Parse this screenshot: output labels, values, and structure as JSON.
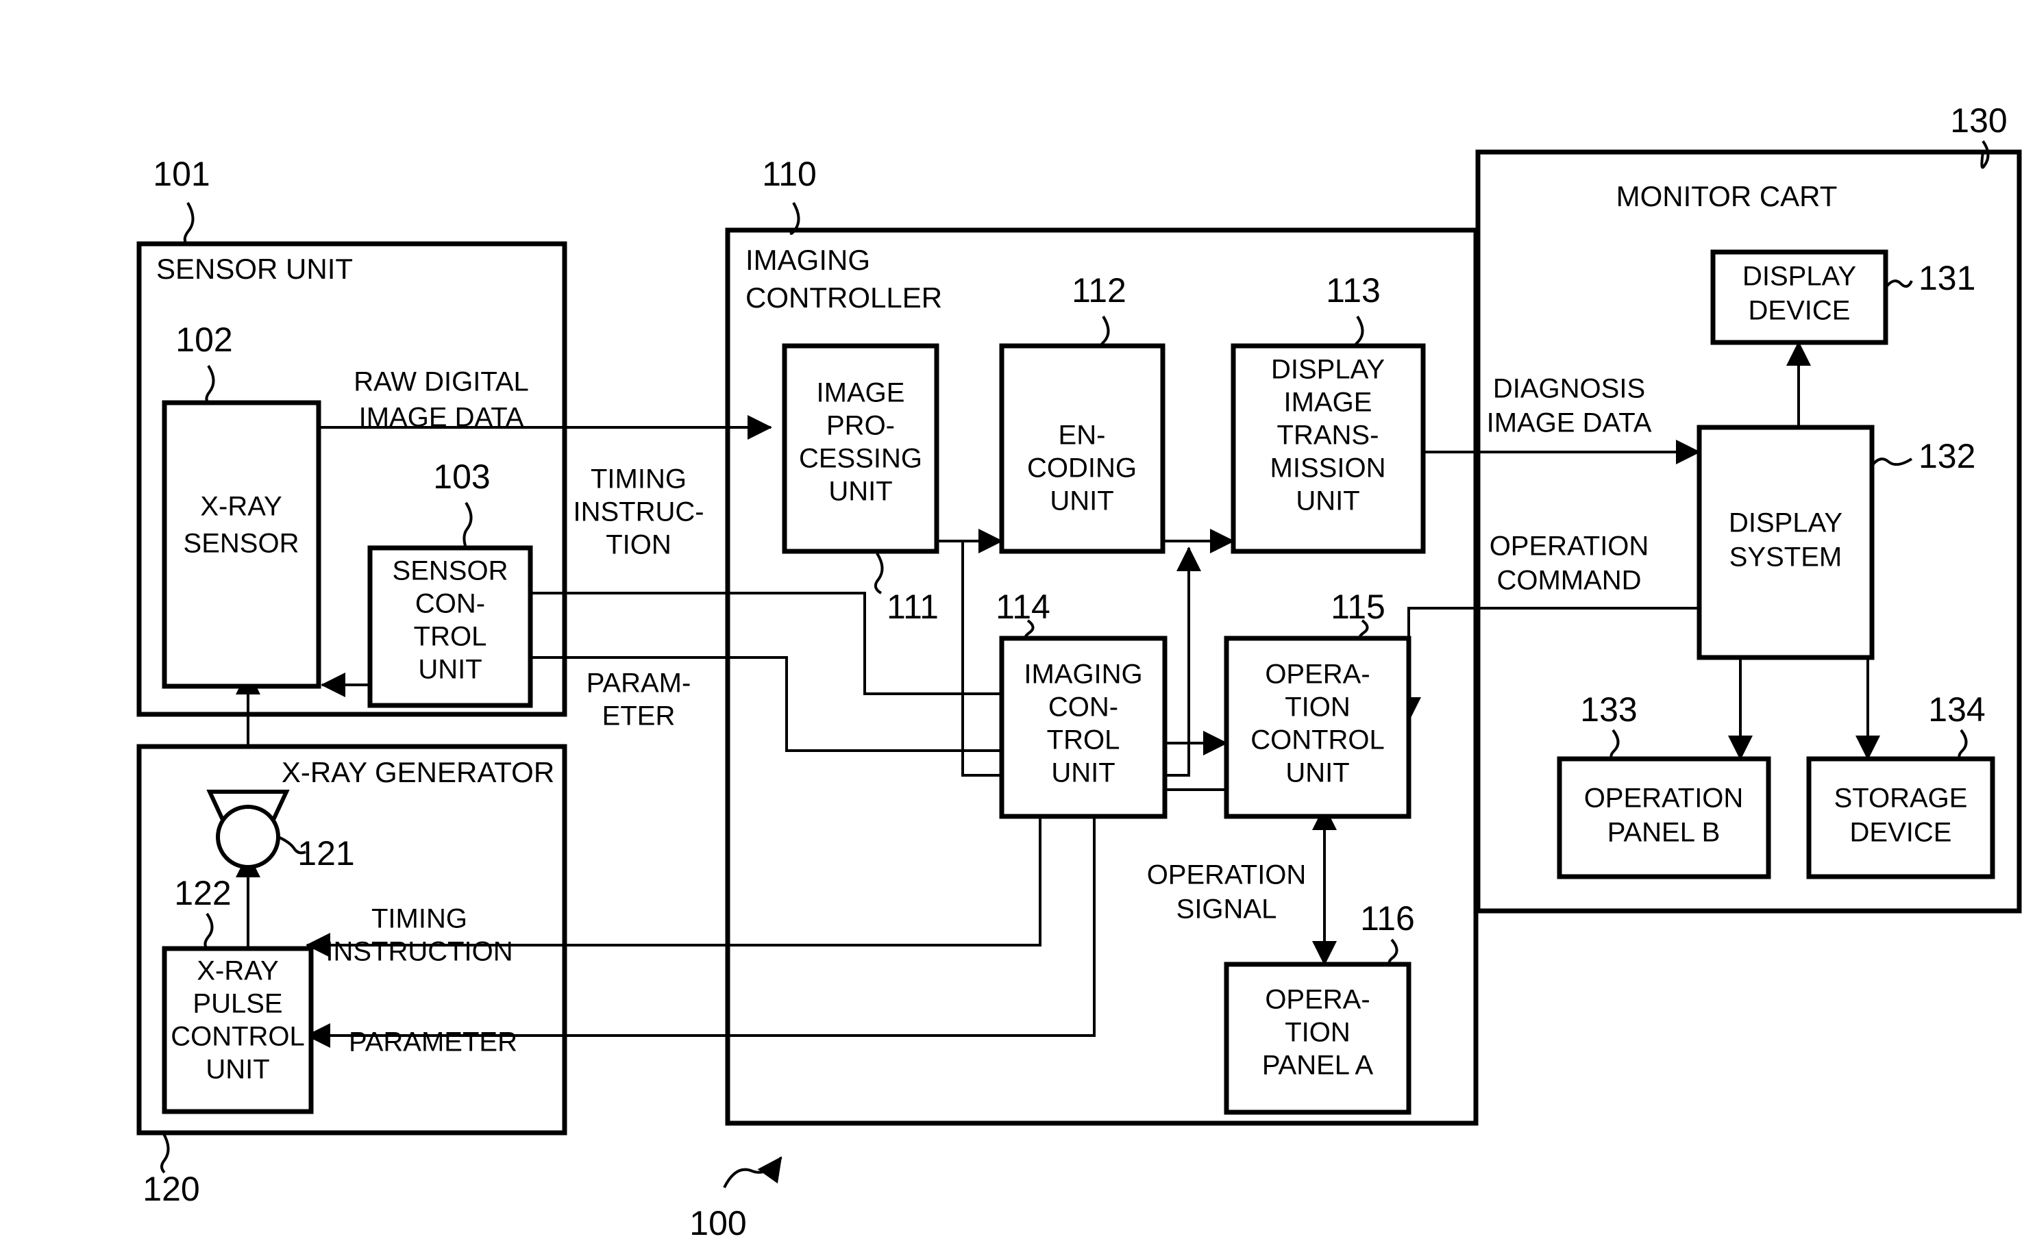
{
  "figure": {
    "system_ref": "100",
    "groups": [
      {
        "id": "sensor_unit",
        "ref": "101",
        "title": "SENSOR UNIT"
      },
      {
        "id": "xray_generator",
        "ref": "120",
        "title": "X-RAY GENERATOR"
      },
      {
        "id": "imaging_controller",
        "ref": "110",
        "title": "IMAGING\nCONTROLLER",
        "title_line1": "IMAGING",
        "title_line2": "CONTROLLER"
      },
      {
        "id": "monitor_cart",
        "ref": "130",
        "title": "MONITOR CART"
      }
    ],
    "blocks": [
      {
        "id": "xray_sensor",
        "ref": "102",
        "lines": [
          "X-RAY",
          "SENSOR"
        ]
      },
      {
        "id": "sensor_control_unit",
        "ref": "103",
        "lines": [
          "SENSOR",
          "CON-",
          "TROL",
          "UNIT"
        ]
      },
      {
        "id": "xray_tube",
        "ref": "121",
        "lines": []
      },
      {
        "id": "xray_pulse_control_unit",
        "ref": "122",
        "lines": [
          "X-RAY",
          "PULSE",
          "CONTROL",
          "UNIT"
        ]
      },
      {
        "id": "image_processing_unit",
        "ref": "111",
        "lines": [
          "IMAGE",
          "PRO-",
          "CESSING",
          "UNIT"
        ]
      },
      {
        "id": "encoding_unit",
        "ref": "112",
        "lines": [
          "EN-",
          "CODING",
          "UNIT"
        ]
      },
      {
        "id": "display_image_transmission_unit",
        "ref": "113",
        "lines": [
          "DISPLAY",
          "IMAGE",
          "TRANS-",
          "MISSION",
          "UNIT"
        ]
      },
      {
        "id": "imaging_control_unit",
        "ref": "114",
        "lines": [
          "IMAGING",
          "CON-",
          "TROL",
          "UNIT"
        ]
      },
      {
        "id": "operation_control_unit",
        "ref": "115",
        "lines": [
          "OPERA-",
          "TION",
          "CONTROL",
          "UNIT"
        ]
      },
      {
        "id": "operation_panel_a",
        "ref": "116",
        "lines": [
          "OPERA-",
          "TION",
          "PANEL A"
        ]
      },
      {
        "id": "display_device",
        "ref": "131",
        "lines": [
          "DISPLAY",
          "DEVICE"
        ]
      },
      {
        "id": "display_system",
        "ref": "132",
        "lines": [
          "DISPLAY",
          "SYSTEM"
        ]
      },
      {
        "id": "operation_panel_b",
        "ref": "133",
        "lines": [
          "OPERATION",
          "PANEL B"
        ]
      },
      {
        "id": "storage_device",
        "ref": "134",
        "lines": [
          "STORAGE",
          "DEVICE"
        ]
      }
    ],
    "signals": [
      {
        "id": "raw_digital_image_data",
        "lines": [
          "RAW DIGITAL",
          "IMAGE DATA"
        ]
      },
      {
        "id": "timing_instruction_sensor",
        "lines": [
          "TIMING",
          "INSTRUC-",
          "TION"
        ]
      },
      {
        "id": "parameter_sensor",
        "lines": [
          "PARAM-",
          "ETER"
        ]
      },
      {
        "id": "timing_instruction_generator",
        "lines": [
          "TIMING",
          "INSTRUCTION"
        ]
      },
      {
        "id": "parameter_generator",
        "lines": [
          "PARAMETER"
        ]
      },
      {
        "id": "operation_signal",
        "lines": [
          "OPERATION",
          "SIGNAL"
        ]
      },
      {
        "id": "diagnosis_image_data",
        "lines": [
          "DIAGNOSIS",
          "IMAGE DATA"
        ]
      },
      {
        "id": "operation_command",
        "lines": [
          "OPERATION",
          "COMMAND"
        ]
      }
    ],
    "text": {
      "sensor_unit_title": "SENSOR UNIT",
      "xray_generator_title": "X-RAY GENERATOR",
      "imaging_controller_title_1": "IMAGING",
      "imaging_controller_title_2": "CONTROLLER",
      "monitor_cart_title": "MONITOR CART",
      "ref_100": "100",
      "ref_101": "101",
      "ref_102": "102",
      "ref_103": "103",
      "ref_110": "110",
      "ref_111": "111",
      "ref_112": "112",
      "ref_113": "113",
      "ref_114": "114",
      "ref_115": "115",
      "ref_116": "116",
      "ref_120": "120",
      "ref_121": "121",
      "ref_122": "122",
      "ref_130": "130",
      "ref_131": "131",
      "ref_132": "132",
      "ref_133": "133",
      "ref_134": "134",
      "xray_sensor_1": "X-RAY",
      "xray_sensor_2": "SENSOR",
      "sensor_control_1": "SENSOR",
      "sensor_control_2": "CON-",
      "sensor_control_3": "TROL",
      "sensor_control_4": "UNIT",
      "xray_pulse_1": "X-RAY",
      "xray_pulse_2": "PULSE",
      "xray_pulse_3": "CONTROL",
      "xray_pulse_4": "UNIT",
      "image_proc_1": "IMAGE",
      "image_proc_2": "PRO-",
      "image_proc_3": "CESSING",
      "image_proc_4": "UNIT",
      "encoding_1": "EN-",
      "encoding_2": "CODING",
      "encoding_3": "UNIT",
      "dit_1": "DISPLAY",
      "dit_2": "IMAGE",
      "dit_3": "TRANS-",
      "dit_4": "MISSION",
      "dit_5": "UNIT",
      "icu_1": "IMAGING",
      "icu_2": "CON-",
      "icu_3": "TROL",
      "icu_4": "UNIT",
      "ocu_1": "OPERA-",
      "ocu_2": "TION",
      "ocu_3": "CONTROL",
      "ocu_4": "UNIT",
      "opa_1": "OPERA-",
      "opa_2": "TION",
      "opa_3": "PANEL A",
      "dd_1": "DISPLAY",
      "dd_2": "DEVICE",
      "ds_1": "DISPLAY",
      "ds_2": "SYSTEM",
      "opb_1": "OPERATION",
      "opb_2": "PANEL B",
      "sd_1": "STORAGE",
      "sd_2": "DEVICE",
      "raw_1": "RAW DIGITAL",
      "raw_2": "IMAGE DATA",
      "ti_s_1": "TIMING",
      "ti_s_2": "INSTRUC-",
      "ti_s_3": "TION",
      "param_s_1": "PARAM-",
      "param_s_2": "ETER",
      "ti_g_1": "TIMING",
      "ti_g_2": "INSTRUCTION",
      "param_g_1": "PARAMETER",
      "opsig_1": "OPERATION",
      "opsig_2": "SIGNAL",
      "diag_1": "DIAGNOSIS",
      "diag_2": "IMAGE DATA",
      "opcmd_1": "OPERATION",
      "opcmd_2": "COMMAND"
    },
    "colors": {
      "ink": "#000000",
      "paper": "#ffffff"
    }
  }
}
